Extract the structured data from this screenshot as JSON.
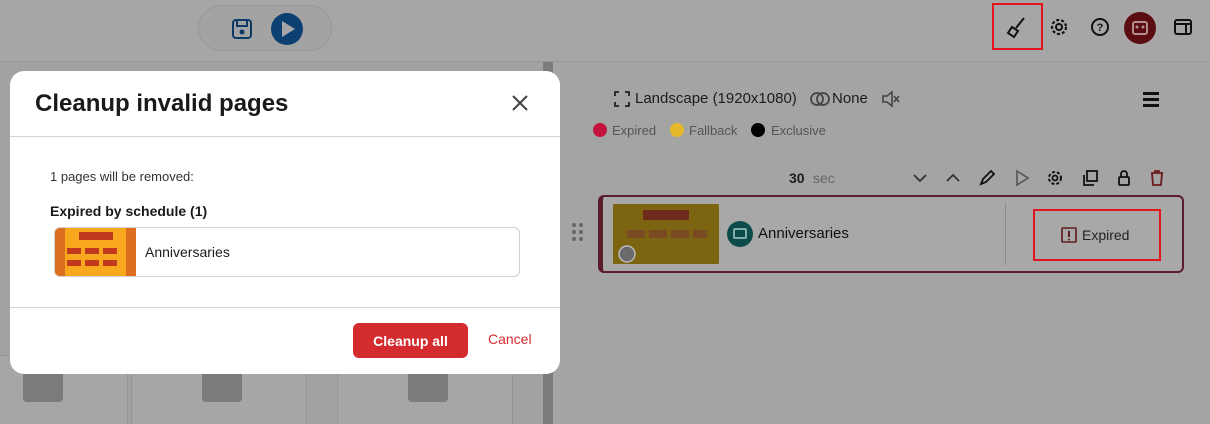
{
  "colors": {
    "accent_red": "#d42b2e",
    "play_blue": "#0c3f72",
    "expired_dot": "#c4143e",
    "fallback_dot": "#e6b92a",
    "exclusive_dot": "#000000",
    "highlight_red": "#e3151d"
  },
  "toolbar": {
    "icons": [
      "save-icon",
      "play-icon",
      "cleanup-brush-icon",
      "settings-gear-icon",
      "help-icon",
      "robot-avatar-icon",
      "layout-panel-icon"
    ]
  },
  "playlist": {
    "orientation": "Landscape (1920x1080)",
    "transition": "None",
    "legend": [
      {
        "label": "Expired",
        "color": "#c4143e"
      },
      {
        "label": "Fallback",
        "color": "#e6b92a"
      },
      {
        "label": "Exclusive",
        "color": "#000000"
      }
    ],
    "duration_value": "30",
    "duration_unit": "sec",
    "page": {
      "name": "Anniversaries",
      "status": "Expired"
    }
  },
  "modal": {
    "title": "Cleanup invalid pages",
    "count_text": "1 pages will be removed:",
    "section_title": "Expired by schedule (1)",
    "items": [
      {
        "name": "Anniversaries"
      }
    ],
    "cleanup_label": "Cleanup all",
    "cancel_label": "Cancel"
  }
}
